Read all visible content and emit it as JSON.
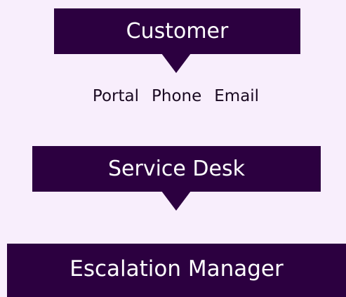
{
  "nodes": {
    "customer": "Customer",
    "service_desk": "Service Desk",
    "escalation_manager": "Escalation Manager"
  },
  "channels": [
    "Portal",
    "Phone",
    "Email"
  ],
  "colors": {
    "background": "#f8eefc",
    "box_fill": "#2c0040",
    "box_text": "#ffffff",
    "channel_text": "#1a0a22"
  }
}
